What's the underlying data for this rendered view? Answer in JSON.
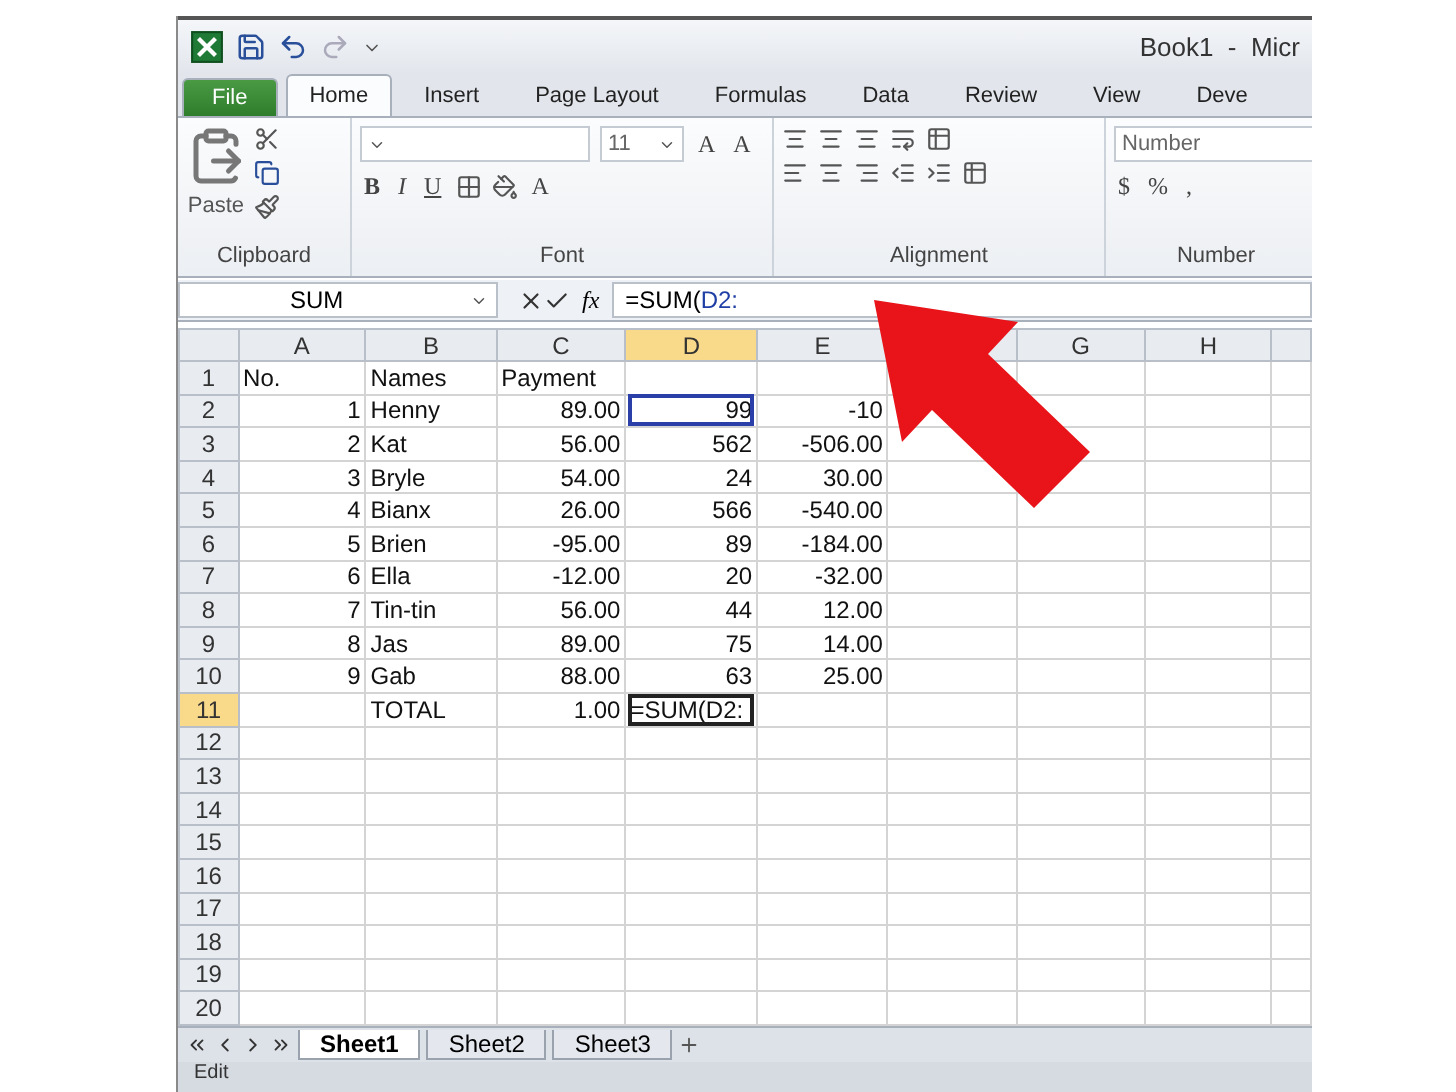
{
  "window": {
    "title": "Book1  -  Micr"
  },
  "ribbon_tabs": [
    {
      "label": "File",
      "kind": "file",
      "selected": false
    },
    {
      "label": "Home",
      "kind": "tab",
      "selected": true
    },
    {
      "label": "Insert",
      "kind": "tab",
      "selected": false
    },
    {
      "label": "Page Layout",
      "kind": "tab",
      "selected": false
    },
    {
      "label": "Formulas",
      "kind": "tab",
      "selected": false
    },
    {
      "label": "Data",
      "kind": "tab",
      "selected": false
    },
    {
      "label": "Review",
      "kind": "tab",
      "selected": false
    },
    {
      "label": "View",
      "kind": "tab",
      "selected": false
    },
    {
      "label": "Deve",
      "kind": "tab",
      "selected": false
    }
  ],
  "ribbon": {
    "clipboard": {
      "label": "Clipboard",
      "paste": "Paste"
    },
    "font": {
      "label": "Font",
      "size": "11",
      "bold": "B",
      "italic": "I",
      "underline": "U",
      "font_color": "A",
      "grow": "A",
      "shrink": "A"
    },
    "alignment": {
      "label": "Alignment"
    },
    "number": {
      "label": "Number",
      "format": "Number",
      "currency": "$",
      "percent": "%",
      "comma": ","
    }
  },
  "formula_bar": {
    "name_box": "SUM",
    "function": "fx",
    "formula": "=SUM(",
    "reference": "D2:"
  },
  "columns": [
    {
      "label": "A",
      "selected": false
    },
    {
      "label": "B",
      "selected": false
    },
    {
      "label": "C",
      "selected": false
    },
    {
      "label": "D",
      "selected": true
    },
    {
      "label": "E",
      "selected": false
    },
    {
      "selected": false
    },
    {
      "label": "G",
      "selected": false
    },
    {
      "label": "H",
      "selected": false
    }
  ],
  "rows": [
    {
      "header": "1",
      "kind": "header",
      "selected": false,
      "a": "No.",
      "b": "Names",
      "c": "Payment"
    },
    {
      "header": "2",
      "kind": "data",
      "selected": false,
      "a": "1",
      "b": "Henny",
      "c": "89.00",
      "d": "99",
      "e": "-10",
      "d_outlined": true
    },
    {
      "header": "3",
      "kind": "data",
      "selected": false,
      "a": "2",
      "b": "Kat",
      "c": "56.00",
      "d": "562",
      "e": "-506.00"
    },
    {
      "header": "4",
      "kind": "data",
      "selected": false,
      "a": "3",
      "b": "Bryle",
      "c": "54.00",
      "d": "24",
      "e": "30.00"
    },
    {
      "header": "5",
      "kind": "data",
      "selected": false,
      "a": "4",
      "b": "Bianx",
      "c": "26.00",
      "d": "566",
      "e": "-540.00"
    },
    {
      "header": "6",
      "kind": "data",
      "selected": false,
      "a": "5",
      "b": "Brien",
      "c": "-95.00",
      "d": "89",
      "e": "-184.00"
    },
    {
      "header": "7",
      "kind": "data",
      "selected": false,
      "a": "6",
      "b": "Ella",
      "c": "-12.00",
      "d": "20",
      "e": "-32.00"
    },
    {
      "header": "8",
      "kind": "data",
      "selected": false,
      "a": "7",
      "b": "Tin-tin",
      "c": "56.00",
      "d": "44",
      "e": "12.00"
    },
    {
      "header": "9",
      "kind": "data",
      "selected": false,
      "a": "8",
      "b": "Jas",
      "c": "89.00",
      "d": "75",
      "e": "14.00"
    },
    {
      "header": "10",
      "kind": "data",
      "selected": false,
      "a": "9",
      "b": "Gab",
      "c": "88.00",
      "d": "63",
      "e": "25.00"
    },
    {
      "header": "11",
      "kind": "data",
      "selected": true,
      "b": "TOTAL",
      "c": "1.00",
      "d": "=SUM(D2:",
      "d_editing": true
    },
    {
      "header": "12",
      "kind": "data",
      "selected": false
    },
    {
      "header": "13",
      "kind": "data",
      "selected": false
    },
    {
      "header": "14",
      "kind": "data",
      "selected": false
    },
    {
      "header": "15",
      "kind": "data",
      "selected": false
    },
    {
      "header": "16",
      "kind": "data",
      "selected": false
    },
    {
      "header": "17",
      "kind": "data",
      "selected": false
    },
    {
      "header": "18",
      "kind": "data",
      "selected": false
    },
    {
      "header": "19",
      "kind": "data",
      "selected": false
    },
    {
      "header": "20",
      "kind": "data",
      "selected": false
    }
  ],
  "sheet_tabs": [
    {
      "label": "Sheet1",
      "selected": true
    },
    {
      "label": "Sheet2",
      "selected": false
    },
    {
      "label": "Sheet3",
      "selected": false
    }
  ],
  "status_bar": {
    "mode": "Edit"
  }
}
